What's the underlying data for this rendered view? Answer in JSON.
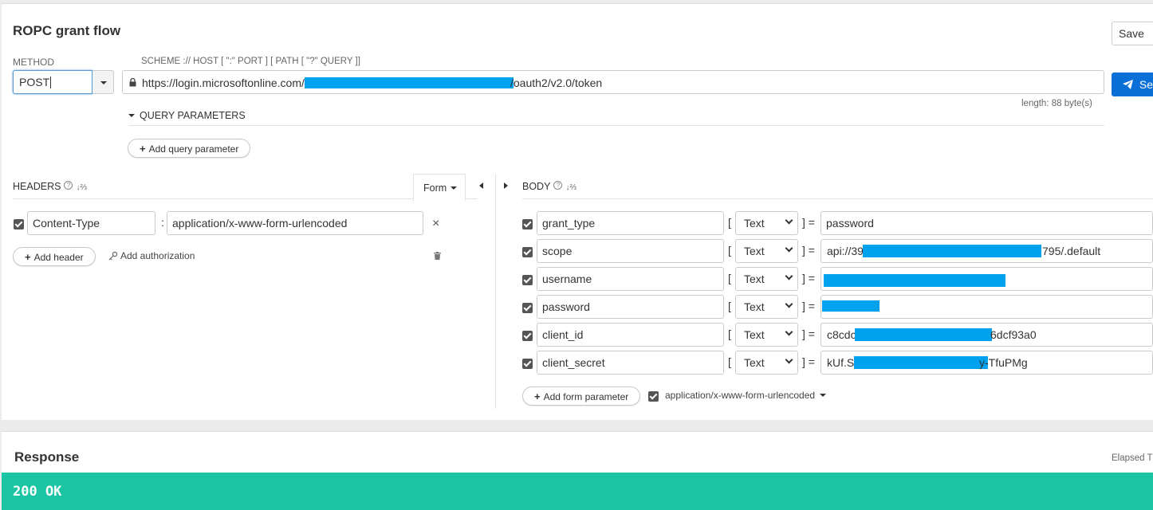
{
  "request": {
    "title": "ROPC grant flow",
    "save_label": "Save",
    "method_label": "METHOD",
    "scheme_label": "SCHEME :// HOST [ \":\" PORT ] [ PATH [ \"?\" QUERY ]]",
    "method_value": "POST",
    "url_prefix": "https://login.microsoftonline.com/",
    "url_suffix": "/oauth2/v2.0/token",
    "send_label": "Se",
    "length_text": "length: 88 byte(s)",
    "query_params_label": "QUERY PARAMETERS",
    "add_query_label": "Add query parameter"
  },
  "headers": {
    "label": "HEADERS",
    "form_label": "Form",
    "rows": [
      {
        "name": "Content-Type",
        "value": "application/x-www-form-urlencoded"
      }
    ],
    "add_header_label": "Add header",
    "add_auth_label": "Add authorization"
  },
  "body": {
    "label": "BODY",
    "rows": [
      {
        "name": "grant_type",
        "type": "Text",
        "value": "password"
      },
      {
        "name": "scope",
        "type": "Text",
        "value_prefix": "api://39",
        "value_suffix": "795/.default"
      },
      {
        "name": "username",
        "type": "Text",
        "value": ""
      },
      {
        "name": "password",
        "type": "Text",
        "value": ""
      },
      {
        "name": "client_id",
        "type": "Text",
        "value_prefix": "c8cdc",
        "value_suffix": "6dcf93a0"
      },
      {
        "name": "client_secret",
        "type": "Text",
        "value_prefix": "kUf.S",
        "value_suffix": "y-TfuPMg"
      }
    ],
    "add_form_label": "Add form parameter",
    "encoding_label": "application/x-www-form-urlencoded"
  },
  "response": {
    "title": "Response",
    "elapsed_label": "Elapsed T",
    "status": "200 OK"
  },
  "colors": {
    "accent": "#0a6fd6",
    "redaction": "#00a2ed",
    "status_ok": "#1bc5a4"
  }
}
